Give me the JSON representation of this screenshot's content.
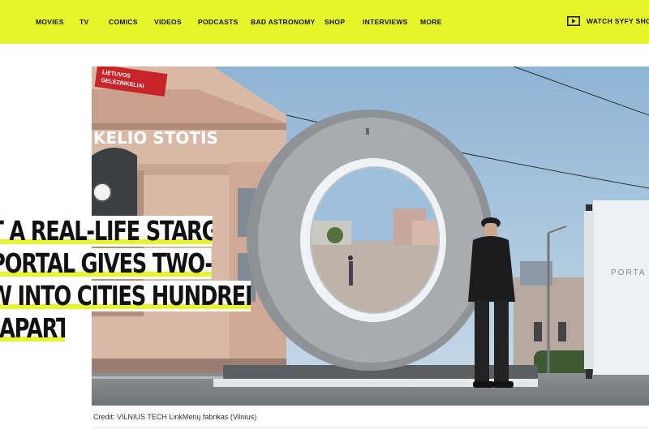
{
  "nav": {
    "items": [
      {
        "label": "MOVIES"
      },
      {
        "label": "TV"
      },
      {
        "label": "COMICS"
      },
      {
        "label": "VIDEOS"
      },
      {
        "label": "PODCASTS"
      },
      {
        "label": "BAD ASTRONOMY"
      },
      {
        "label": "SHOP"
      },
      {
        "label": "INTERVIEWS"
      },
      {
        "label": "MORE"
      }
    ],
    "watch_label": "WATCH SYFY SHOWS",
    "watch_icon": "play-icon"
  },
  "hero": {
    "sign_text": "LIETUVOS\nGELEZINKELIAI",
    "station_text": "KELIO STOTIS",
    "kiosk_text": "PORTA"
  },
  "headline": {
    "lines": [
      "ST A REAL-LIFE STARGATE:",
      "I PORTAL GIVES TWO-WAY",
      "OW INTO CITIES HUNDREDS OF",
      "S APART"
    ]
  },
  "credit": "Credit: VILNIUS TECH LinkMenų fabrikas (Vilnius)",
  "colors": {
    "accent": "#e6f52a",
    "text": "#111111"
  }
}
